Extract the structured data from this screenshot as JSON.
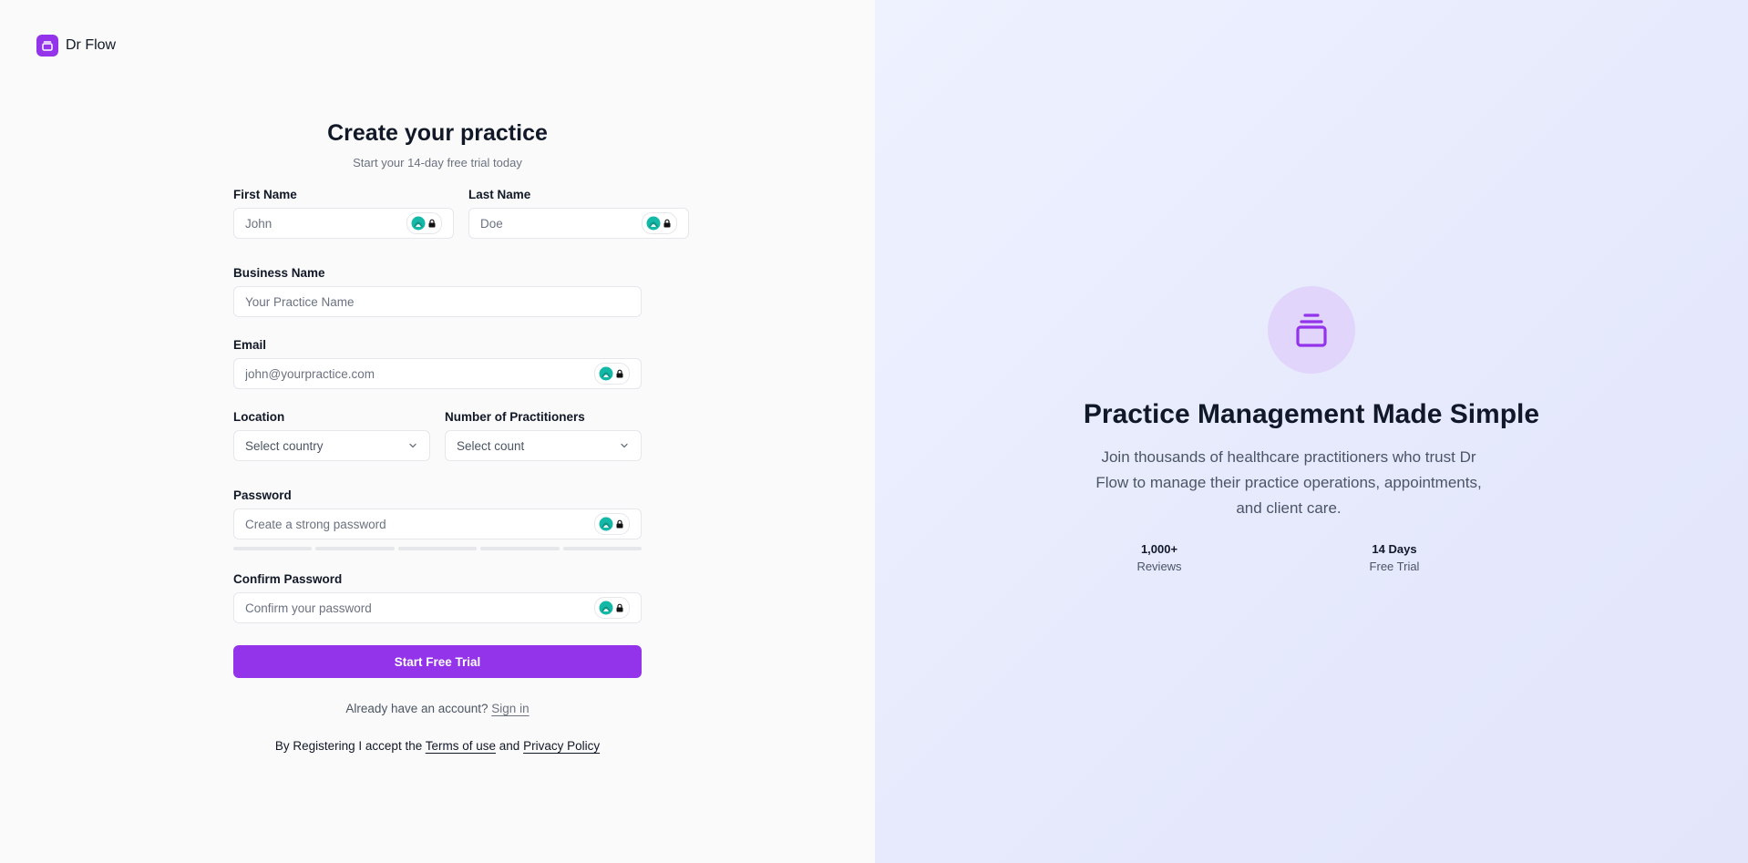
{
  "brand": {
    "name": "Dr Flow",
    "accent_color": "#9333ea"
  },
  "form": {
    "title": "Create your practice",
    "subtitle": "Start your 14-day free trial today",
    "first_name": {
      "label": "First Name",
      "placeholder": "John",
      "value": ""
    },
    "last_name": {
      "label": "Last Name",
      "placeholder": "Doe",
      "value": ""
    },
    "business_name": {
      "label": "Business Name",
      "placeholder": "Your Practice Name",
      "value": ""
    },
    "email": {
      "label": "Email",
      "placeholder": "john@yourpractice.com",
      "value": ""
    },
    "location": {
      "label": "Location",
      "selected": "Select country"
    },
    "practitioners": {
      "label": "Number of Practitioners",
      "selected": "Select count"
    },
    "password": {
      "label": "Password",
      "placeholder": "Create a strong password",
      "value": "",
      "strength_segments_filled": 0,
      "strength_segments_total": 5
    },
    "confirm_password": {
      "label": "Confirm Password",
      "placeholder": "Confirm your password",
      "value": ""
    },
    "submit_label": "Start Free Trial",
    "signin_prompt": "Already have an account?",
    "signin_link": "Sign in",
    "terms_prefix": "By Registering I accept the",
    "terms_link": "Terms of use",
    "terms_and": "and",
    "privacy_link": "Privacy Policy"
  },
  "hero": {
    "icon": "stacked-layers-icon",
    "title": "Practice Management Made Simple",
    "text": "Join thousands of healthcare practitioners who trust Dr Flow to manage their practice operations, appointments, and client care.",
    "stats": [
      {
        "value": "1,000+",
        "label": "Reviews"
      },
      {
        "value": "14 Days",
        "label": "Free Trial"
      }
    ]
  },
  "colors": {
    "primary": "#9333ea",
    "left_background": "#fafafa",
    "right_background": "#e8ebfc",
    "password_manager_teal": "#14b8a6"
  }
}
